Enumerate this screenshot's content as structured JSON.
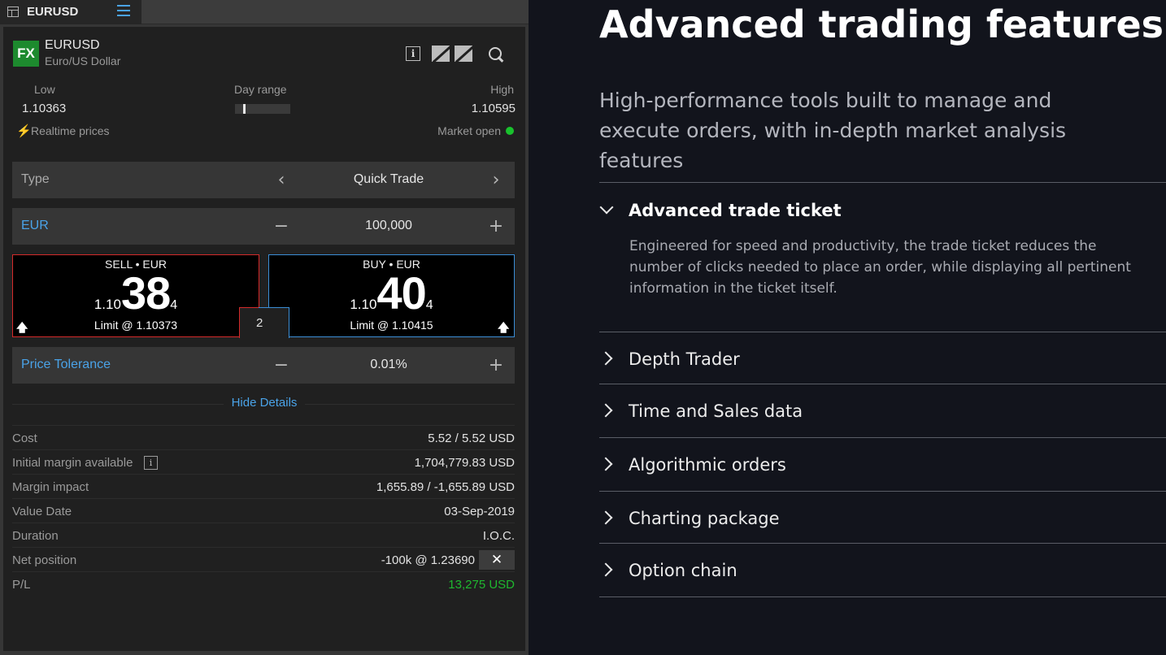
{
  "window": {
    "tab_title": "EURUSD"
  },
  "instrument": {
    "badge": "FX",
    "symbol": "EURUSD",
    "name": "Euro/US Dollar"
  },
  "range": {
    "low_label": "Low",
    "low_value": "1.10363",
    "day_range_label": "Day range",
    "position_fraction": 0.15,
    "high_label": "High",
    "high_value": "1.10595"
  },
  "status": {
    "realtime_label": "Realtime prices",
    "market_label": "Market open",
    "market_color": "#19c22d"
  },
  "type_row": {
    "label": "Type",
    "value": "Quick Trade",
    "prev_icon": "chevron-left-icon",
    "next_icon": "chevron-right-icon"
  },
  "amount_row": {
    "label": "EUR",
    "value": "100,000",
    "minus": "−",
    "plus": "+"
  },
  "sell": {
    "title": "SELL • EUR",
    "price_prefix": "1.10",
    "price_big": "38",
    "price_pip": "4",
    "limit": "Limit @ 1.10373",
    "color": "#d42a2a"
  },
  "buy": {
    "title": "BUY • EUR",
    "price_prefix": "1.10",
    "price_big": "40",
    "price_pip": "4",
    "limit": "Limit @ 1.10415",
    "color": "#3b8ed6"
  },
  "spread": "2",
  "tolerance_row": {
    "label": "Price Tolerance",
    "value": "0.01%",
    "minus": "−",
    "plus": "+"
  },
  "hide_details": "Hide Details",
  "details": [
    {
      "label": "Cost",
      "value": "5.52 / 5.52 USD"
    },
    {
      "label": "Initial margin available",
      "value": "1,704,779.83 USD"
    },
    {
      "label": "Margin impact",
      "value": "1,655.89 / -1,655.89 USD"
    },
    {
      "label": "Value Date",
      "value": "03-Sep-2019"
    },
    {
      "label": "Duration",
      "value": "I.O.C."
    },
    {
      "label": "Net position",
      "value": "-100k @ 1.23690"
    },
    {
      "label": "P/L",
      "value": "13,275 USD"
    }
  ],
  "marketing": {
    "headline": "Advanced trading features",
    "subhead": "High-performance tools built to manage and execute orders, with in-depth market analysis features",
    "accordion": [
      {
        "title": "Advanced trade ticket",
        "expanded": true,
        "body": "Engineered for speed and productivity, the trade ticket reduces the number of clicks needed to place an order, while displaying all pertinent information in the ticket itself."
      },
      {
        "title": "Depth Trader",
        "expanded": false
      },
      {
        "title": "Time and Sales data",
        "expanded": false
      },
      {
        "title": "Algorithmic orders",
        "expanded": false
      },
      {
        "title": "Charting package",
        "expanded": false
      },
      {
        "title": "Option chain",
        "expanded": false
      }
    ]
  }
}
